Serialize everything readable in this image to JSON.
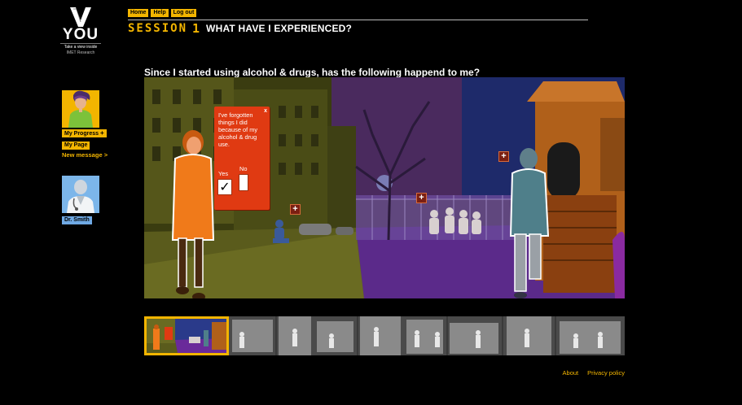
{
  "brand": {
    "logo_letter": "V",
    "logo_word": "YOU",
    "tagline": "Take a view inside",
    "org": "IMET Research"
  },
  "nav": {
    "home": "Home",
    "help": "Help",
    "logout": "Log out"
  },
  "sidebar": {
    "my_progress": "My Progress",
    "my_progress_plus": "+",
    "my_page": "My Page",
    "new_message": "New message >",
    "doctor_name": "Dr. Smith"
  },
  "session": {
    "label": "SESSION",
    "number": "1",
    "title": "WHAT HAVE I EXPERIENCED?"
  },
  "question": "Since I started using alcohol & drugs, has the following happend to me?",
  "popup": {
    "close": "x",
    "statement": "I've forgotten things I did because of my alcohol & drug use.",
    "yes_label": "Yes",
    "no_label": "No",
    "yes_mark": "✓"
  },
  "hotspot_symbol": "+",
  "footer": {
    "about": "About",
    "privacy": "Privacy policy"
  },
  "colors": {
    "accent": "#f3b500",
    "doctor_blue": "#6fa9e4",
    "popup_red": "#e03a12",
    "background": "#000000"
  }
}
